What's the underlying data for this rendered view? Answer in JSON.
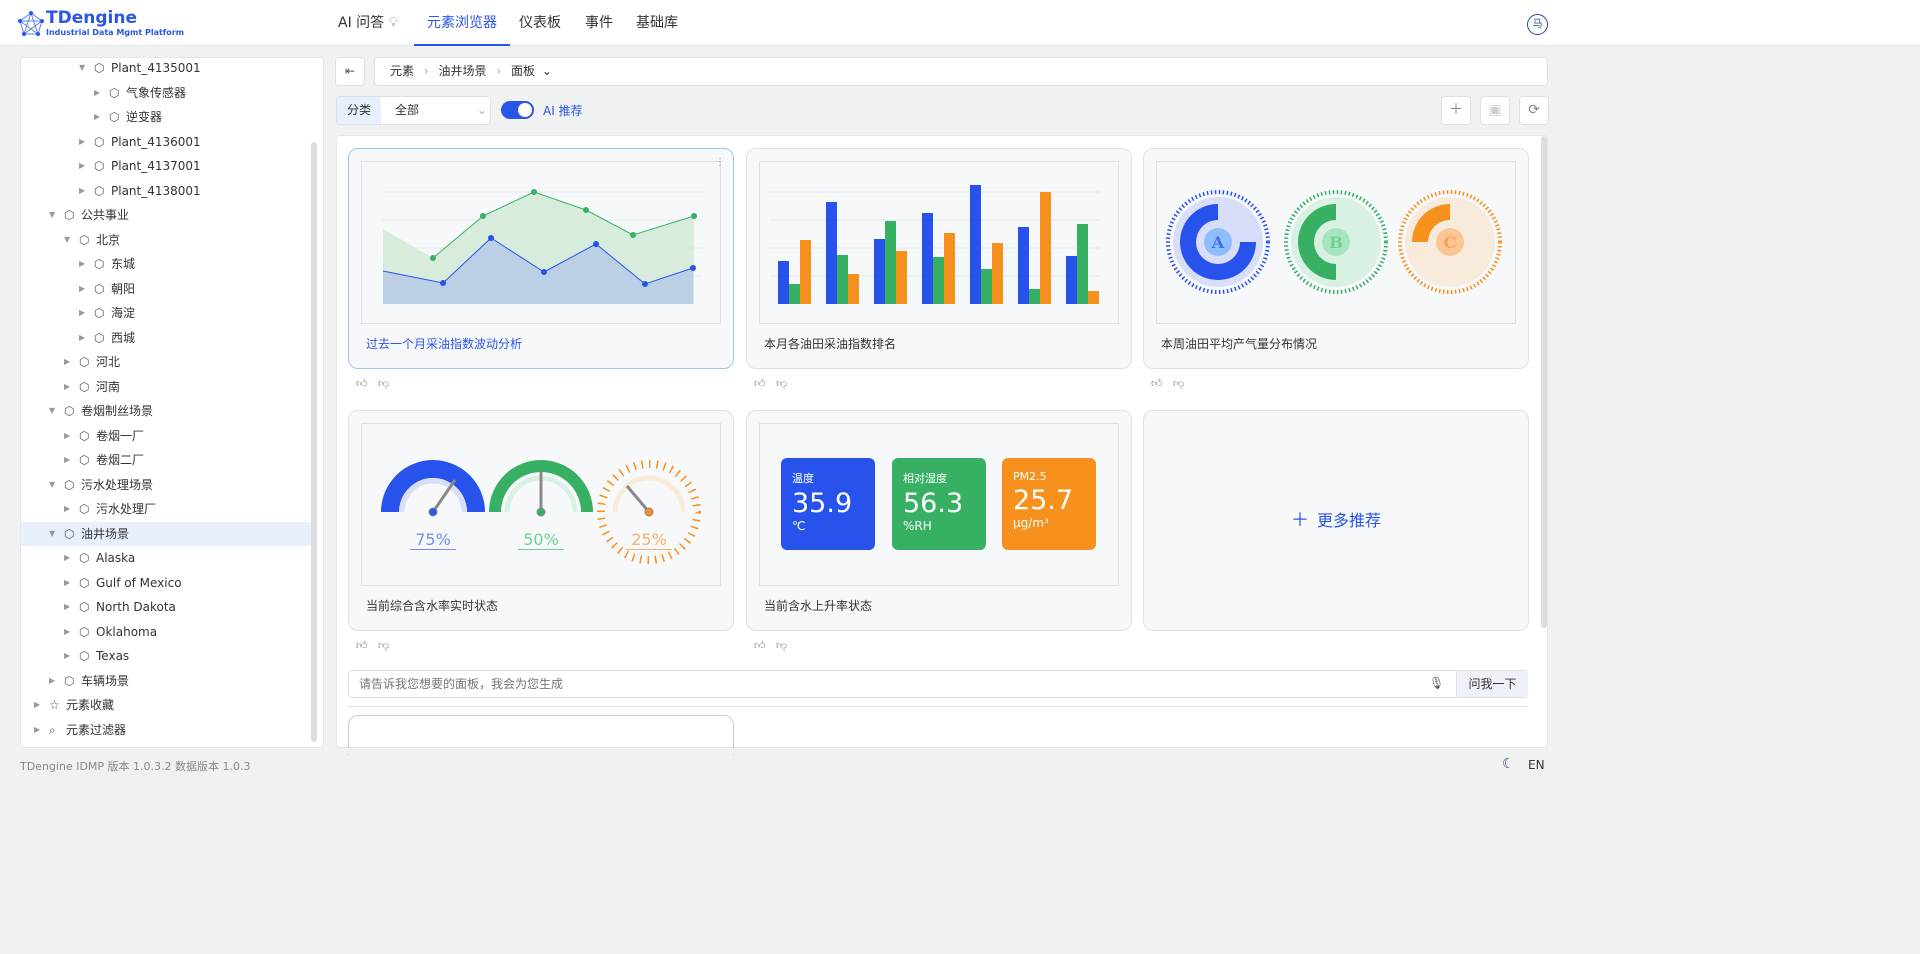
{
  "header": {
    "logo_title": "TDengine",
    "logo_subtitle": "Industrial Data Mgmt Platform",
    "nav": [
      {
        "label": "AI 问答"
      },
      {
        "label": "元素浏览器",
        "active": true
      },
      {
        "label": "仪表板"
      },
      {
        "label": "事件"
      },
      {
        "label": "基础库"
      }
    ],
    "avatar": "马"
  },
  "tree": [
    {
      "label": "Plant_4135001",
      "level": 3,
      "expanded": true
    },
    {
      "label": "气象传感器",
      "level": 4
    },
    {
      "label": "逆变器",
      "level": 4
    },
    {
      "label": "Plant_4136001",
      "level": 3
    },
    {
      "label": "Plant_4137001",
      "level": 3
    },
    {
      "label": "Plant_4138001",
      "level": 3
    },
    {
      "label": "公共事业",
      "level": 1,
      "expanded": true
    },
    {
      "label": "北京",
      "level": 2,
      "expanded": true
    },
    {
      "label": "东城",
      "level": 3
    },
    {
      "label": "朝阳",
      "level": 3
    },
    {
      "label": "海淀",
      "level": 3
    },
    {
      "label": "西城",
      "level": 3
    },
    {
      "label": "河北",
      "level": 2
    },
    {
      "label": "河南",
      "level": 2
    },
    {
      "label": "卷烟制丝场景",
      "level": 1,
      "expanded": true
    },
    {
      "label": "卷烟一厂",
      "level": 2
    },
    {
      "label": "卷烟二厂",
      "level": 2
    },
    {
      "label": "污水处理场景",
      "level": 1,
      "expanded": true
    },
    {
      "label": "污水处理厂",
      "level": 2
    },
    {
      "label": "油井场景",
      "level": 1,
      "expanded": true,
      "selected": true
    },
    {
      "label": "Alaska",
      "level": 2
    },
    {
      "label": "Gulf of Mexico",
      "level": 2
    },
    {
      "label": "North Dakota",
      "level": 2
    },
    {
      "label": "Oklahoma",
      "level": 2
    },
    {
      "label": "Texas",
      "level": 2
    },
    {
      "label": "车辆场景",
      "level": 1
    },
    {
      "label": "元素收藏",
      "level": 0,
      "icon": "favorites-icon"
    },
    {
      "label": "元素过滤器",
      "level": 0,
      "icon": "filter-icon"
    }
  ],
  "breadcrumb": [
    "元素",
    "油井场景",
    "面板"
  ],
  "filter": {
    "label": "分类",
    "value": "全部",
    "ai_toggle_label": "AI 推荐",
    "ai_toggle_on": true
  },
  "cards": [
    {
      "title": "过去一个月采油指数波动分析"
    },
    {
      "title": "本月各油田采油指数排名"
    },
    {
      "title": "本周油田平均产气量分布情况",
      "donuts": [
        "A",
        "B",
        "C"
      ]
    },
    {
      "title": "当前综合含水率实时状态",
      "gauges": [
        "75%",
        "50%",
        "25%"
      ]
    },
    {
      "title": "当前含水上升率状态",
      "tiles": [
        {
          "label": "温度",
          "value": "35.9",
          "unit": "℃"
        },
        {
          "label": "相对湿度",
          "value": "56.3",
          "unit": "%RH"
        },
        {
          "label": "PM2.5",
          "value": "25.7",
          "unit": "μg/m³"
        }
      ]
    },
    {
      "title": "更多推荐"
    }
  ],
  "colors": {
    "blue": "#2753ec",
    "green": "#37b064",
    "orange": "#f7911e",
    "accent": "#2b55e6"
  },
  "prompt": {
    "placeholder": "请告诉我您想要的面板，我会为您生成",
    "button": "问我一下"
  },
  "footer": {
    "version": "TDengine IDMP 版本 1.0.3.2 数据版本 1.0.3",
    "lang": "EN"
  }
}
